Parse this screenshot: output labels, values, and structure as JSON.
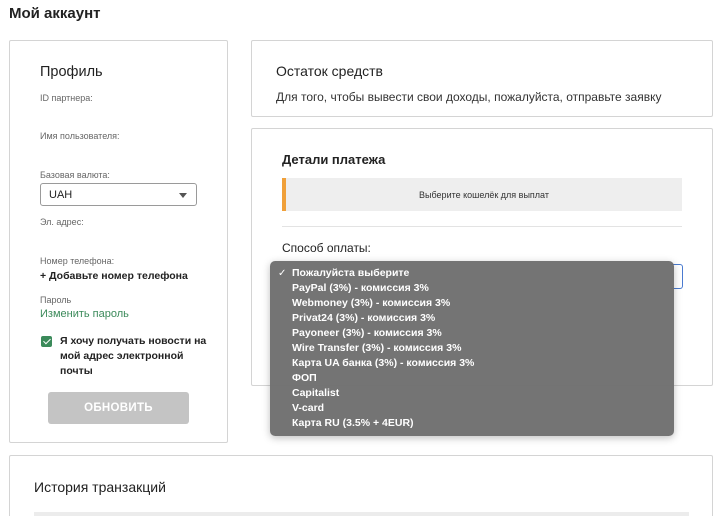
{
  "page": {
    "title": "Мой аккаунт"
  },
  "profile": {
    "title": "Профиль",
    "partner_id_label": "ID партнера:",
    "username_label": "Имя пользователя:",
    "currency_label": "Базовая валюта:",
    "currency_value": "UAH",
    "email_label": "Эл. адрес:",
    "phone_label": "Номер телефона:",
    "add_phone": "+ Добавьте номер телефона",
    "password_label": "Пароль",
    "change_password": "Изменить пароль",
    "newsletter_checked": true,
    "newsletter_text": "Я хочу получать новости на мой адрес электронной почты",
    "update_button": "ОБНОВИТЬ"
  },
  "balance": {
    "title": "Остаток средств",
    "text": "Для того, чтобы вывести свои доходы, пожалуйста, отправьте заявку"
  },
  "payment": {
    "title": "Детали платежа",
    "notice": "Выберите кошелёк для выплат",
    "method_label": "Способ оплаты:"
  },
  "transactions": {
    "title": "История транзакций"
  },
  "dropdown": {
    "selected_index": 0,
    "options": [
      "Пожалуйста выберите",
      "PayPal (3%) - комиссия 3%",
      "Webmoney (3%) - комиссия 3%",
      "Privat24 (3%) - комиссия 3%",
      "Payoneer (3%) - комиссия 3%",
      "Wire Transfer (3%) - комиссия 3%",
      "Карта UA банка (3%) - комиссия 3%",
      "ФОП",
      "Capitalist",
      "V-card",
      "Карта RU (3.5% + 4EUR)"
    ]
  },
  "colors": {
    "accent_green": "#3b8a5a",
    "notice_border": "#f0a03a",
    "focus_blue": "#4a7bd0"
  }
}
